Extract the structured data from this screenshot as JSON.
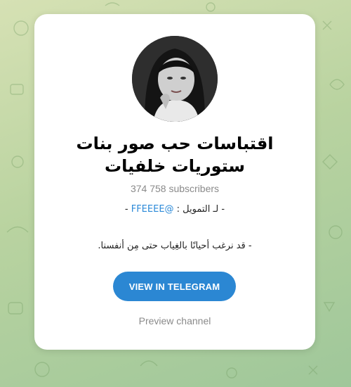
{
  "channel": {
    "title_line1": "اقتباسات حب صور بنات",
    "title_line2": "ستوريات خلفيات",
    "subscribers": "374 758 subscribers",
    "description_line1_prefix": "- لـ التمويل : ",
    "description_line1_link": "@FFEEEE",
    "description_line1_suffix": " -",
    "description_line2": "- قد نرغب أحيانًا بالغِياب حتى مِن أنفسنا."
  },
  "actions": {
    "view_button": "VIEW IN TELEGRAM",
    "preview_link": "Preview channel"
  },
  "colors": {
    "accent": "#2b87d3",
    "link": "#2c8ad8",
    "muted_text": "#8a8a8a",
    "background": "#b9d3a0"
  },
  "icons": {
    "avatar": "channel-avatar-photo"
  }
}
